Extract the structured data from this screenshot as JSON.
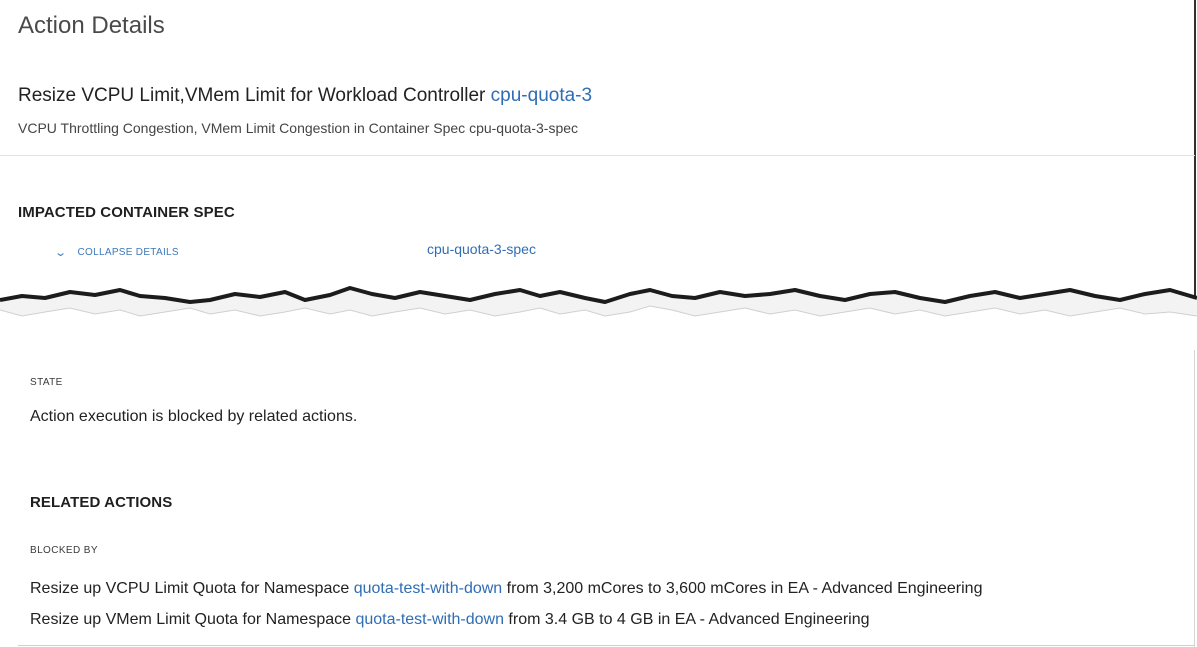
{
  "panel": {
    "title": "Action Details"
  },
  "action": {
    "prefix": "Resize VCPU Limit,VMem Limit for Workload Controller ",
    "target_link": "cpu-quota-3",
    "subtitle": "VCPU Throttling Congestion, VMem Limit Congestion in Container Spec cpu-quota-3-spec"
  },
  "impacted": {
    "heading": "IMPACTED CONTAINER SPEC",
    "collapse_label": "COLLAPSE DETAILS",
    "collapse_icon": "chevron-down-icon",
    "spec_link": "cpu-quota-3-spec"
  },
  "state": {
    "label": "STATE",
    "text": "Action execution is blocked by related actions."
  },
  "related": {
    "heading": "RELATED ACTIONS",
    "blocked_by_label": "BLOCKED BY",
    "items": [
      {
        "prefix": "Resize up VCPU Limit Quota for Namespace ",
        "link": "quota-test-with-down",
        "suffix": " from 3,200 mCores to 3,600 mCores in EA - Advanced Engineering"
      },
      {
        "prefix": "Resize up VMem Limit Quota for Namespace ",
        "link": "quota-test-with-down",
        "suffix": " from 3.4 GB to 4 GB in EA - Advanced Engineering"
      }
    ]
  },
  "colors": {
    "link": "#2f6db5",
    "text": "#222222",
    "muted": "#4a4a4a"
  }
}
